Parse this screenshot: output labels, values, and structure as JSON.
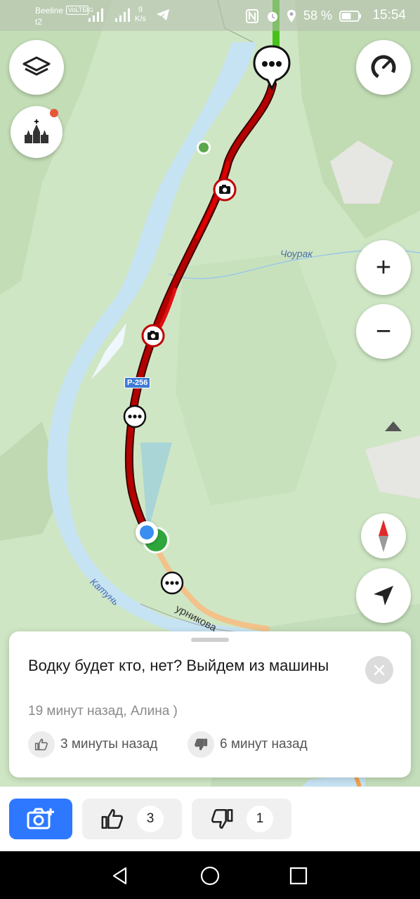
{
  "status_bar": {
    "carrier": "Beeline",
    "carrier_badge": "VoLTE",
    "carrier2": "t2",
    "net_type": "4G",
    "speed_value": "9",
    "speed_unit": "K/s",
    "battery": "58 %",
    "time": "15:54"
  },
  "map": {
    "river_name": "Катунь",
    "stream_name": "Чоурак",
    "road_badge": "Р-256",
    "street_name": "урникова",
    "colors": {
      "traffic_jam": "#b30000",
      "traffic_dark": "#6b0000",
      "river": "#c6e3f3",
      "land": "#cfe6c4",
      "free_road": "#46c21a"
    }
  },
  "map_controls": {
    "layers": "layers-icon",
    "places": "church-icon",
    "profile": "speedometer-icon",
    "zoom_in": "+",
    "zoom_out": "−",
    "compass": "compass-icon",
    "locate": "navigation-arrow-icon"
  },
  "card": {
    "message": "Водку будет кто, нет? Выйдем из машины",
    "meta": "19 минут назад, Алина )",
    "like_time": "3 минуты назад",
    "dislike_time": "6 минут назад"
  },
  "actions": {
    "like_count": "3",
    "dislike_count": "1",
    "accent": "#2e78ff"
  }
}
